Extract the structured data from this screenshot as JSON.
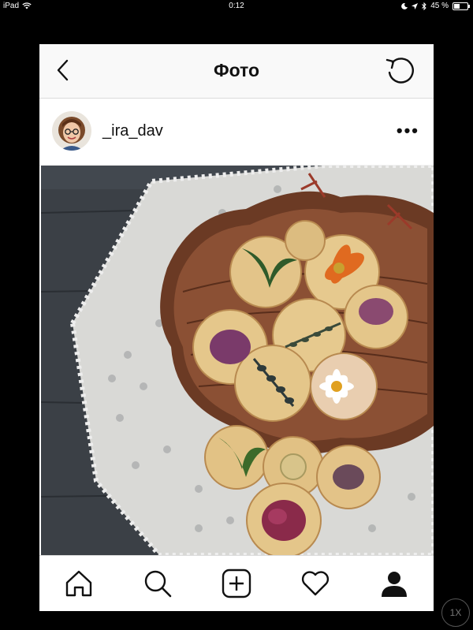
{
  "status_bar": {
    "device": "iPad",
    "time": "0:12",
    "battery_percent": "45 %"
  },
  "navbar": {
    "title": "Фото"
  },
  "post": {
    "username": "_ira_dav",
    "more_label": "•••"
  },
  "icons": {
    "back": "chevron-left-icon",
    "refresh": "refresh-icon",
    "home": "home-icon",
    "search": "search-icon",
    "add": "add-post-icon",
    "activity": "heart-icon",
    "profile": "profile-icon"
  },
  "zoom_label": "1X"
}
